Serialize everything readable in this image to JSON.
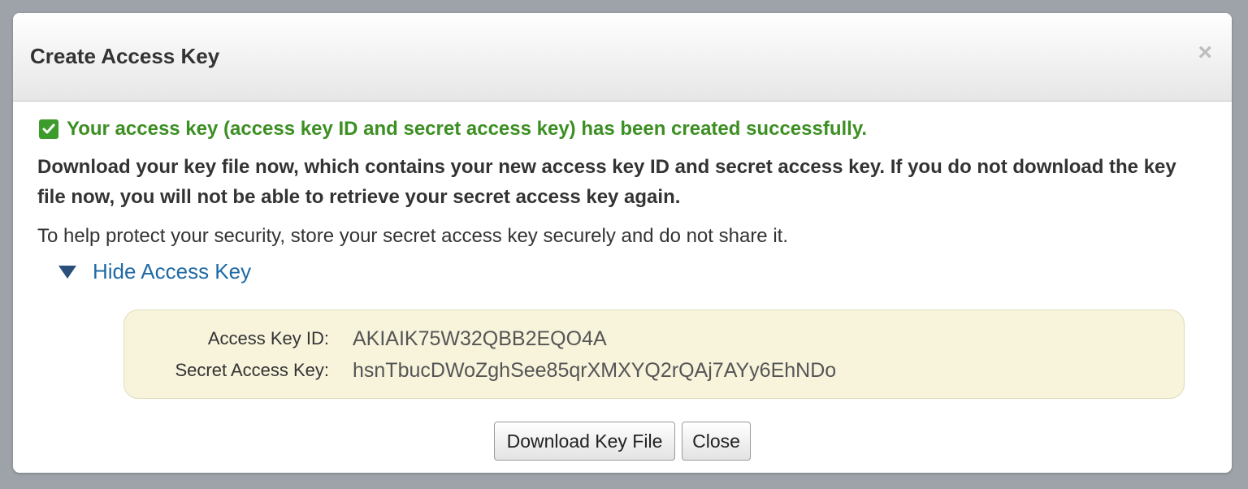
{
  "dialog": {
    "title": "Create Access Key",
    "close_glyph": "×"
  },
  "message": {
    "success": "Your access key (access key ID and secret access key) has been created successfully.",
    "warning": "Download your key file now, which contains your new access key ID and secret access key. If you do not download the key file now, you will not be able to retrieve your secret access key again.",
    "protect": "To help protect your security, store your secret access key securely and do not share it."
  },
  "toggle": {
    "label": "Hide Access Key"
  },
  "keys": {
    "access_key_id_label": "Access Key ID:",
    "access_key_id_value": "AKIAIK75W32QBB2EQO4A",
    "secret_key_label": "Secret Access Key:",
    "secret_key_value": "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"
  },
  "buttons": {
    "download": "Download Key File",
    "close": "Close"
  },
  "colors": {
    "success": "#3c8f22",
    "link": "#1f6aa5",
    "key_box_bg": "#f8f4dc"
  },
  "icons": {
    "success": "checkbox-check-icon",
    "toggle": "triangle-down-icon",
    "close": "close-icon"
  }
}
